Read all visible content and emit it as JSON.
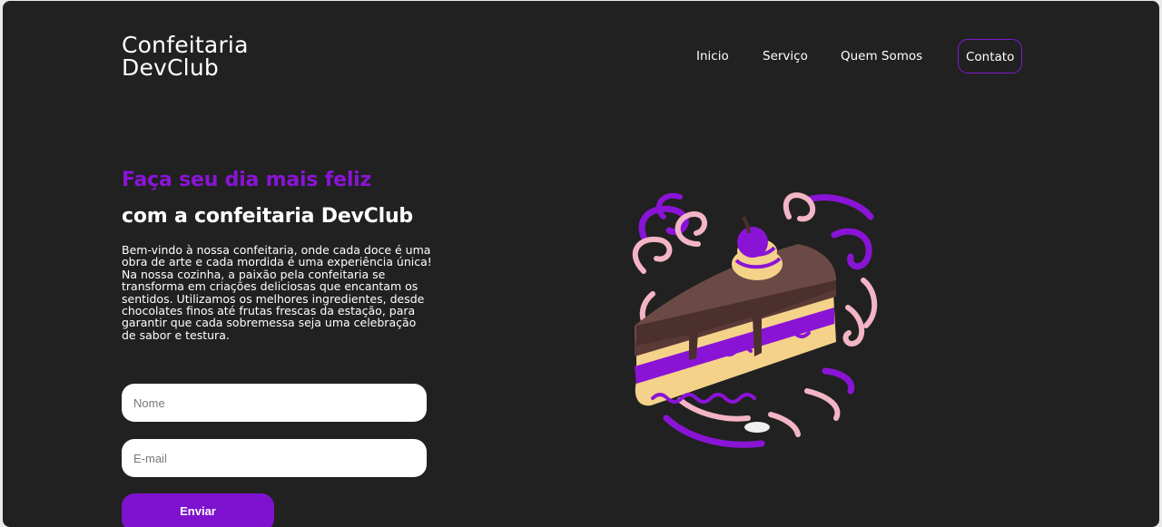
{
  "header": {
    "logo_line1": "Confeitaria",
    "logo_line2": "DevClub",
    "nav": {
      "inicio": "Inicio",
      "servico": "Serviço",
      "quem_somos": "Quem Somos",
      "contato": "Contato"
    }
  },
  "hero": {
    "headline_accent": "Faça seu dia mais feliz",
    "headline_main": "com a confeitaria DevClub",
    "intro": "Bem-vindo à nossa confeitaria, onde cada doce é uma obra de arte e cada mordida é uma experiência única! Na nossa cozinha, a paixão pela confeitaria se transforma em criações deliciosas que encantam os sentidos. Utilizamos os melhores ingredientes, desde chocolates finos até frutas frescas da estação, para garantir que cada sobremessa seja uma celebração de sabor e testura."
  },
  "form": {
    "name_placeholder": "Nome",
    "email_placeholder": "E-mail",
    "submit_label": "Enviar"
  },
  "illustration": {
    "icon": "cake-slice-icon"
  },
  "colors": {
    "background": "#212121",
    "accent": "#8a14d6",
    "button": "#7e12cf",
    "text": "#ffffff"
  }
}
